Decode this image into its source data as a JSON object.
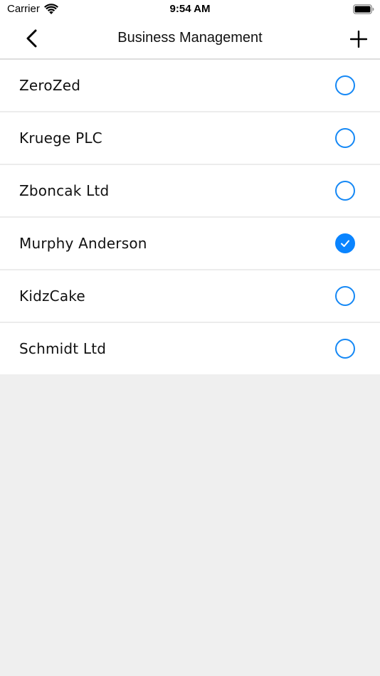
{
  "status_bar": {
    "carrier": "Carrier",
    "time": "9:54 AM",
    "icons": [
      "wifi-icon",
      "battery-icon"
    ]
  },
  "nav": {
    "title": "Business Management",
    "back_icon": "chevron-left-icon",
    "add_icon": "plus-icon"
  },
  "colors": {
    "accent": "#0A84FF",
    "background": "#EFEFEF",
    "row": "#FFFFFF"
  },
  "businesses": [
    {
      "name": "ZeroZed",
      "selected": false
    },
    {
      "name": "Kruege PLC",
      "selected": false
    },
    {
      "name": "Zboncak Ltd",
      "selected": false
    },
    {
      "name": "Murphy Anderson",
      "selected": true
    },
    {
      "name": "KidzCake",
      "selected": false
    },
    {
      "name": "Schmidt Ltd",
      "selected": false
    }
  ]
}
